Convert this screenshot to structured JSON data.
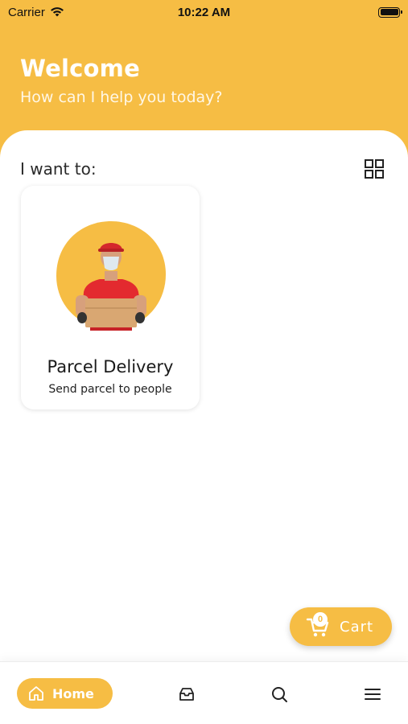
{
  "status_bar": {
    "carrier": "Carrier",
    "time": "10:22 AM"
  },
  "header": {
    "title": "Welcome",
    "subtitle": "How can I help you today?"
  },
  "main": {
    "section_title": "I want to:",
    "services": [
      {
        "title": "Parcel Delivery",
        "subtitle": "Send parcel to people",
        "icon": "delivery-person-illustration"
      }
    ]
  },
  "cart": {
    "badge_count": "0",
    "label": "Cart"
  },
  "bottom_nav": {
    "items": [
      {
        "label": "Home",
        "icon": "home-icon",
        "active": true
      },
      {
        "icon": "inbox-icon"
      },
      {
        "icon": "search-icon"
      },
      {
        "icon": "menu-icon"
      }
    ]
  },
  "colors": {
    "accent": "#f6bd44",
    "background": "#ffffff",
    "text": "#1a1a1a"
  }
}
